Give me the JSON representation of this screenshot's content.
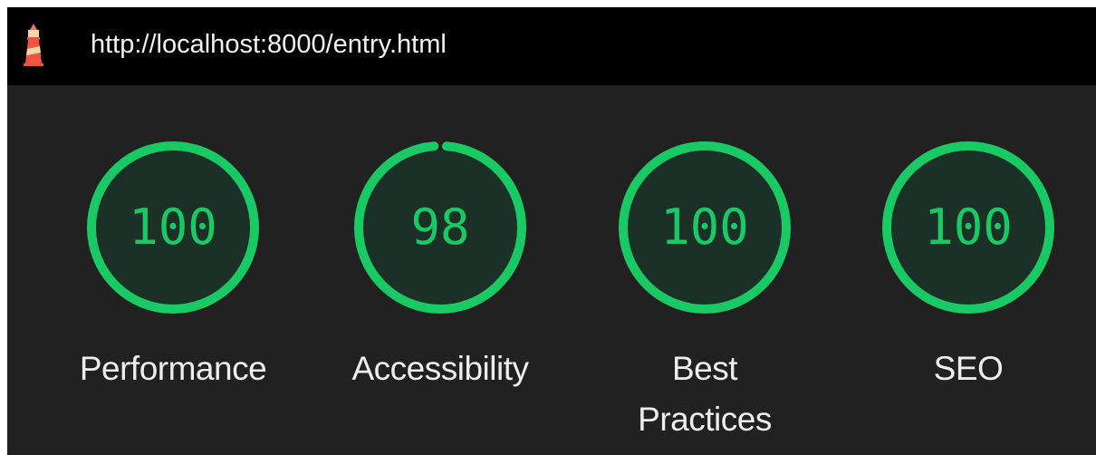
{
  "header": {
    "url": "http://localhost:8000/entry.html",
    "logo_icon": "lighthouse-icon"
  },
  "colors": {
    "pass": "#18c964",
    "gauge_fill": "#1b3127",
    "background": "#212121",
    "urlbar": "#000000"
  },
  "categories": [
    {
      "label": "Performance",
      "score": 100
    },
    {
      "label": "Accessibility",
      "score": 98
    },
    {
      "label": "Best Practices",
      "label_lines": [
        "Best",
        "Practices"
      ],
      "score": 100
    },
    {
      "label": "SEO",
      "score": 100
    }
  ]
}
